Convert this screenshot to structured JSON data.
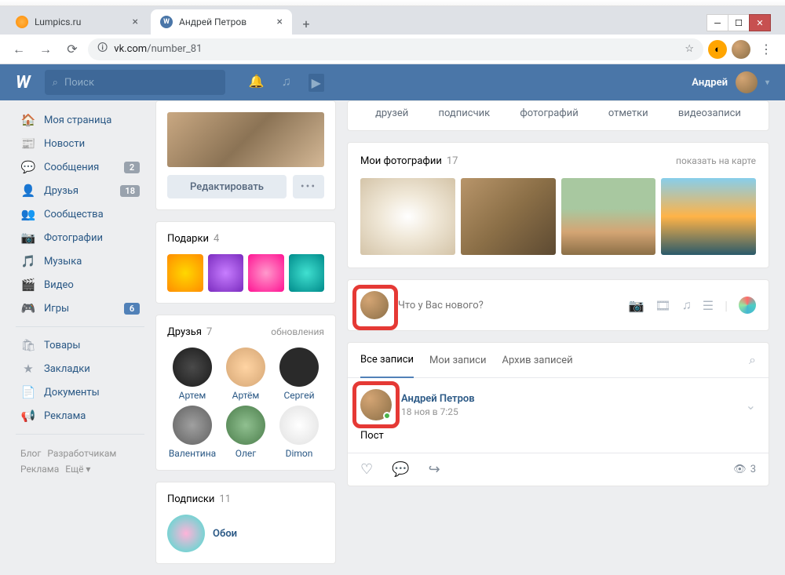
{
  "browser": {
    "tabs": [
      {
        "title": "Lumpics.ru",
        "active": false,
        "icon": "lumpics"
      },
      {
        "title": "Андрей Петров",
        "active": true,
        "icon": "vk"
      }
    ],
    "url_domain": "vk.com",
    "url_path": "/number_81"
  },
  "vk_header": {
    "search_placeholder": "Поиск",
    "user_name": "Андрей"
  },
  "left_nav": {
    "items": [
      {
        "icon": "🏠",
        "label": "Моя страница",
        "badge": null
      },
      {
        "icon": "📰",
        "label": "Новости",
        "badge": null
      },
      {
        "icon": "💬",
        "label": "Сообщения",
        "badge": "2",
        "badge_style": "gray"
      },
      {
        "icon": "👤",
        "label": "Друзья",
        "badge": "18",
        "badge_style": "gray"
      },
      {
        "icon": "👥",
        "label": "Сообщества",
        "badge": null
      },
      {
        "icon": "📷",
        "label": "Фотографии",
        "badge": null
      },
      {
        "icon": "🎵",
        "label": "Музыка",
        "badge": null
      },
      {
        "icon": "🎬",
        "label": "Видео",
        "badge": null
      },
      {
        "icon": "🎮",
        "label": "Игры",
        "badge": "6",
        "badge_style": "blue"
      }
    ],
    "items2": [
      {
        "icon": "🛍",
        "label": "Товары"
      },
      {
        "icon": "★",
        "label": "Закладки"
      },
      {
        "icon": "📄",
        "label": "Документы"
      },
      {
        "icon": "📢",
        "label": "Реклама"
      }
    ],
    "footer": [
      "Блог",
      "Разработчикам",
      "Реклама",
      "Ещё ▾"
    ]
  },
  "profile": {
    "edit_label": "Редактировать",
    "gifts_title": "Подарки",
    "gifts_count": "4",
    "friends_title": "Друзья",
    "friends_count": "7",
    "friends_updates": "обновления",
    "friends": [
      {
        "name": "Артем",
        "bg": "radial-gradient(circle, #4a4a4a, #1a1a1a)"
      },
      {
        "name": "Артём",
        "bg": "radial-gradient(circle, #ffd4a3, #d4a574)"
      },
      {
        "name": "Сергей",
        "bg": "#2a2a2a"
      },
      {
        "name": "Валентина",
        "bg": "radial-gradient(circle, #a0a0a0, #606060)"
      },
      {
        "name": "Олег",
        "bg": "radial-gradient(circle, #90c090, #4a7c4a)"
      },
      {
        "name": "Dimon",
        "bg": "radial-gradient(circle, #fff, #e0e0e0)"
      }
    ],
    "subs_title": "Подписки",
    "subs_count": "11",
    "sub_name": "Обои"
  },
  "main": {
    "stat_labels": [
      "друзей",
      "подписчик",
      "фотографий",
      "отметки",
      "видеозаписи"
    ],
    "photos_title": "Мои фотографии",
    "photos_count": "17",
    "photos_map_link": "показать на карте",
    "photos": [
      {
        "bg": "radial-gradient(ellipse at center, #fff, #f0e8d8 40%, #d4c4a8)"
      },
      {
        "bg": "linear-gradient(135deg, #b8956a, #8b6f47, #5d4a32)"
      },
      {
        "bg": "linear-gradient(#a8c8a0 40%, #d4a574, #8b6f47)"
      },
      {
        "bg": "linear-gradient(#87ceeb, #ffb347 50%, #2a5a6a)"
      }
    ],
    "newpost_placeholder": "Что у Вас нового?",
    "wall_tabs": [
      "Все записи",
      "Мои записи",
      "Архив записей"
    ],
    "post": {
      "author": "Андрей Петров",
      "date": "18 ноя в 7:25",
      "text": "Пост",
      "views": "3"
    }
  }
}
